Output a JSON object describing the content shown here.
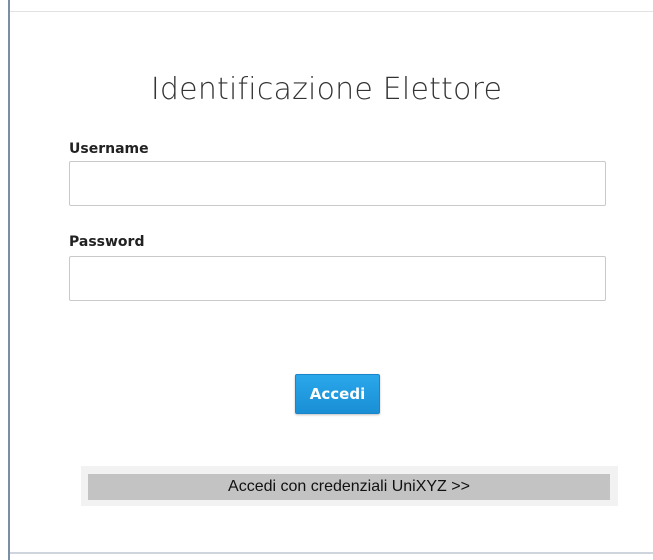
{
  "form": {
    "title": "Identificazione Elettore",
    "username_label": "Username",
    "username_value": "",
    "password_label": "Password",
    "password_value": "",
    "submit_label": "Accedi",
    "alt_login_label": "Accedi con credenziali UniXYZ >>"
  },
  "colors": {
    "primary_button": "#1a8fd6",
    "alt_button_bg": "#c3c3c3"
  }
}
